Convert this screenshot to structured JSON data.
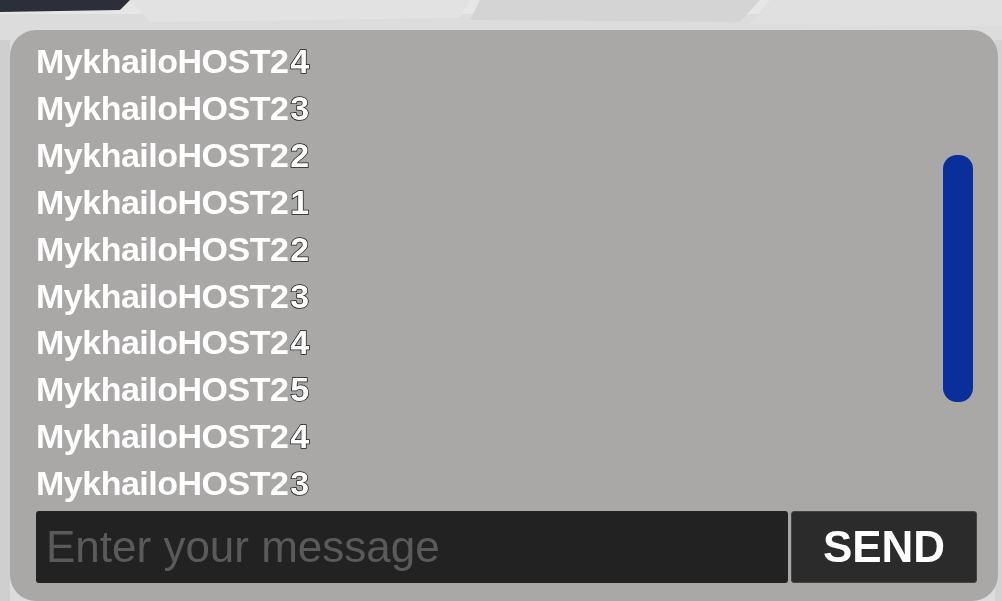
{
  "chat": {
    "messages": [
      {
        "sender": "MykhailoHOST2",
        "text": "4"
      },
      {
        "sender": "MykhailoHOST2",
        "text": "3"
      },
      {
        "sender": "MykhailoHOST2",
        "text": "2"
      },
      {
        "sender": "MykhailoHOST2",
        "text": "1"
      },
      {
        "sender": "MykhailoHOST2",
        "text": "2"
      },
      {
        "sender": "MykhailoHOST2",
        "text": "3"
      },
      {
        "sender": "MykhailoHOST2",
        "text": "4"
      },
      {
        "sender": "MykhailoHOST2",
        "text": "5"
      },
      {
        "sender": "MykhailoHOST2",
        "text": "4"
      },
      {
        "sender": "MykhailoHOST2",
        "text": "3"
      }
    ],
    "input": {
      "placeholder": "Enter your message"
    },
    "send_button": "SEND"
  }
}
